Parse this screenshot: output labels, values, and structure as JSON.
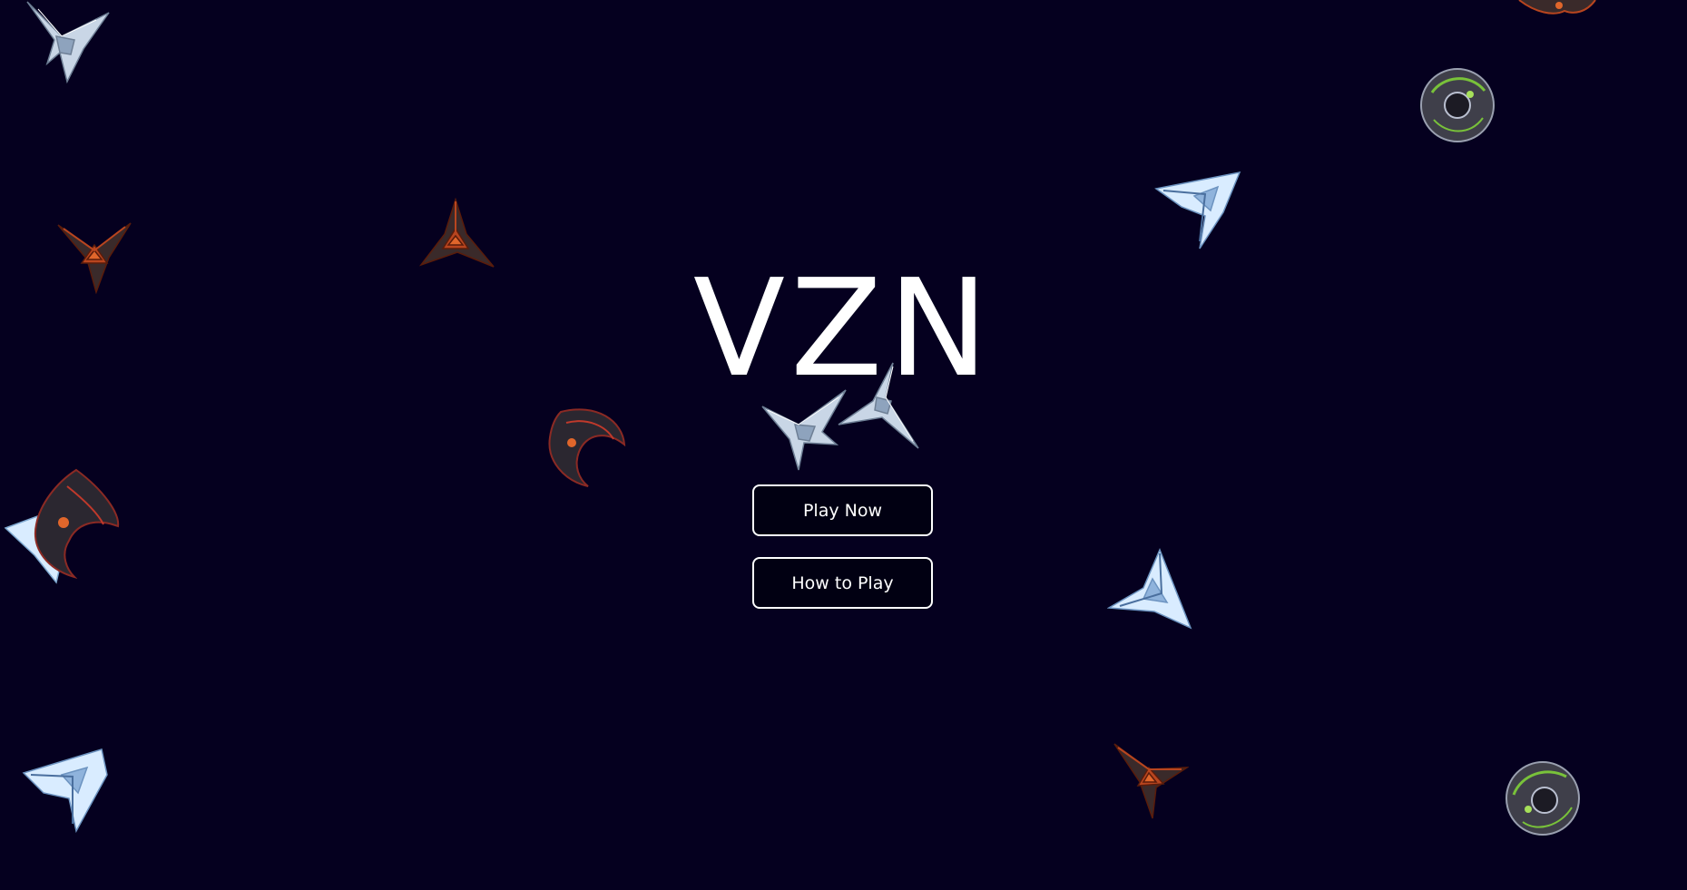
{
  "game": {
    "title": "VZN"
  },
  "menu": {
    "play_label": "Play Now",
    "how_to_play_label": "How to Play"
  },
  "colors": {
    "background": "#05001f",
    "text": "#ffffff",
    "button_fill": "#010012",
    "button_border": "#ffffff",
    "ship_silver": "#c9d6e6",
    "ship_ice": "#d9ecff",
    "ship_rust": "#b8451f",
    "ship_dark": "#2b2730",
    "ship_green": "#79c23a"
  },
  "sprites": {
    "kinds": [
      "silver-fighter",
      "ice-cruiser",
      "rust-tri-ship",
      "dark-crescent-ship",
      "green-orb-ship"
    ]
  }
}
